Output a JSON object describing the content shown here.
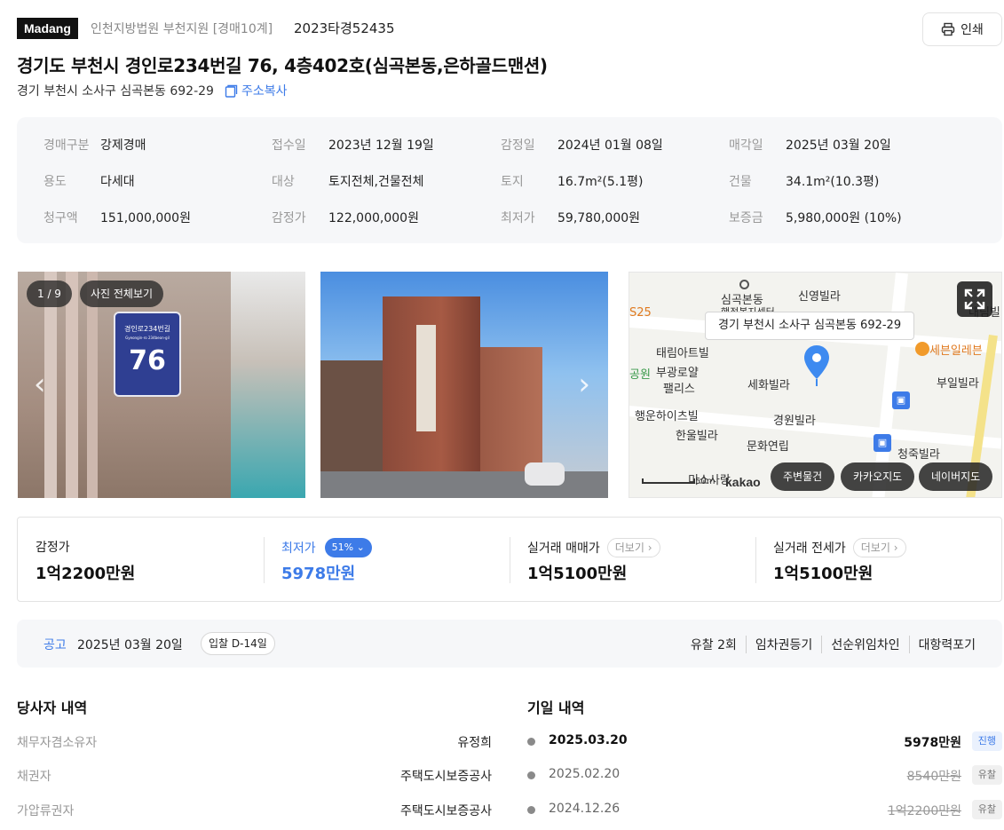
{
  "header": {
    "brand": "Madang",
    "court": "인천지방법원 부천지원 [경매10계]",
    "case_no": "2023타경52435",
    "print_label": "인쇄",
    "title": "경기도 부천시 경인로234번길 76, 4층402호(심곡본동,은하골드맨션)",
    "lot_address": "경기 부천시 소사구 심곡본동 692-29",
    "copy_label": "주소복사"
  },
  "summary": [
    {
      "k": "경매구분",
      "v": "강제경매"
    },
    {
      "k": "접수일",
      "v": "2023년 12월 19일"
    },
    {
      "k": "감정일",
      "v": "2024년 01월 08일"
    },
    {
      "k": "매각일",
      "v": "2025년 03월 20일"
    },
    {
      "k": "용도",
      "v": "다세대"
    },
    {
      "k": "대상",
      "v": "토지전체,건물전체"
    },
    {
      "k": "토지",
      "v": "16.7m²(5.1평)"
    },
    {
      "k": "건물",
      "v": "34.1m²(10.3평)"
    },
    {
      "k": "청구액",
      "v": "151,000,000원"
    },
    {
      "k": "감정가",
      "v": "122,000,000원"
    },
    {
      "k": "최저가",
      "v": "59,780,000원"
    },
    {
      "k": "보증금",
      "v": "5,980,000원 (10%)"
    }
  ],
  "gallery": {
    "counter": "1 / 9",
    "view_all": "사진 전체보기",
    "sign_street": "경인로234번길",
    "sign_roman": "Gyeongin-ro 234beon-gil",
    "sign_number": "76"
  },
  "map": {
    "tooltip": "경기 부천시 소사구 심곡본동 692-29",
    "labels": [
      "심곡본동",
      "행정복지센터",
      "신영빌라",
      "S25",
      "태림아트빌",
      "부광로얄",
      "팰리스",
      "세화빌라",
      "세븐일레븐",
      "부일빌라",
      "공원",
      "행운하이츠빌",
      "한울빌라",
      "경원빌라",
      "문화연립",
      "청죽빌라",
      "미소사랑",
      "대림빌"
    ],
    "scale": "50m",
    "provider": "kakao",
    "buttons": [
      "주변물건",
      "카카오지도",
      "네이버지도"
    ]
  },
  "prices": {
    "appraised": {
      "label": "감정가",
      "value": "1억2200만원"
    },
    "minimum": {
      "label": "최저가",
      "pct": "51%",
      "value": "5978만원"
    },
    "sale": {
      "label": "실거래 매매가",
      "more": "더보기",
      "value": "1억5100만원"
    },
    "jeonse": {
      "label": "실거래 전세가",
      "more": "더보기",
      "value": "1억5100만원"
    }
  },
  "notice": {
    "label": "공고",
    "date": "2025년 03월 20일",
    "dday": "입찰 D-14일",
    "tags": [
      "유찰 2회",
      "임차권등기",
      "선순위임차인",
      "대항력포기"
    ]
  },
  "parties": {
    "title": "당사자 내역",
    "rows": [
      {
        "k": "채무자겸소유자",
        "v": "유정희"
      },
      {
        "k": "채권자",
        "v": "주택도시보증공사"
      },
      {
        "k": "가압류권자",
        "v": "주택도시보증공사"
      }
    ]
  },
  "dates": {
    "title": "기일 내역",
    "rows": [
      {
        "date": "2025.03.20",
        "price": "5978만원",
        "status": "진행"
      },
      {
        "date": "2025.02.20",
        "price": "8540만원",
        "status": "유찰"
      },
      {
        "date": "2024.12.26",
        "price": "1억2200만원",
        "status": "유찰"
      }
    ]
  },
  "colors": {
    "accent": "#3d7be8",
    "brand_bg": "#111111",
    "map_pin": "#3d8af0"
  }
}
